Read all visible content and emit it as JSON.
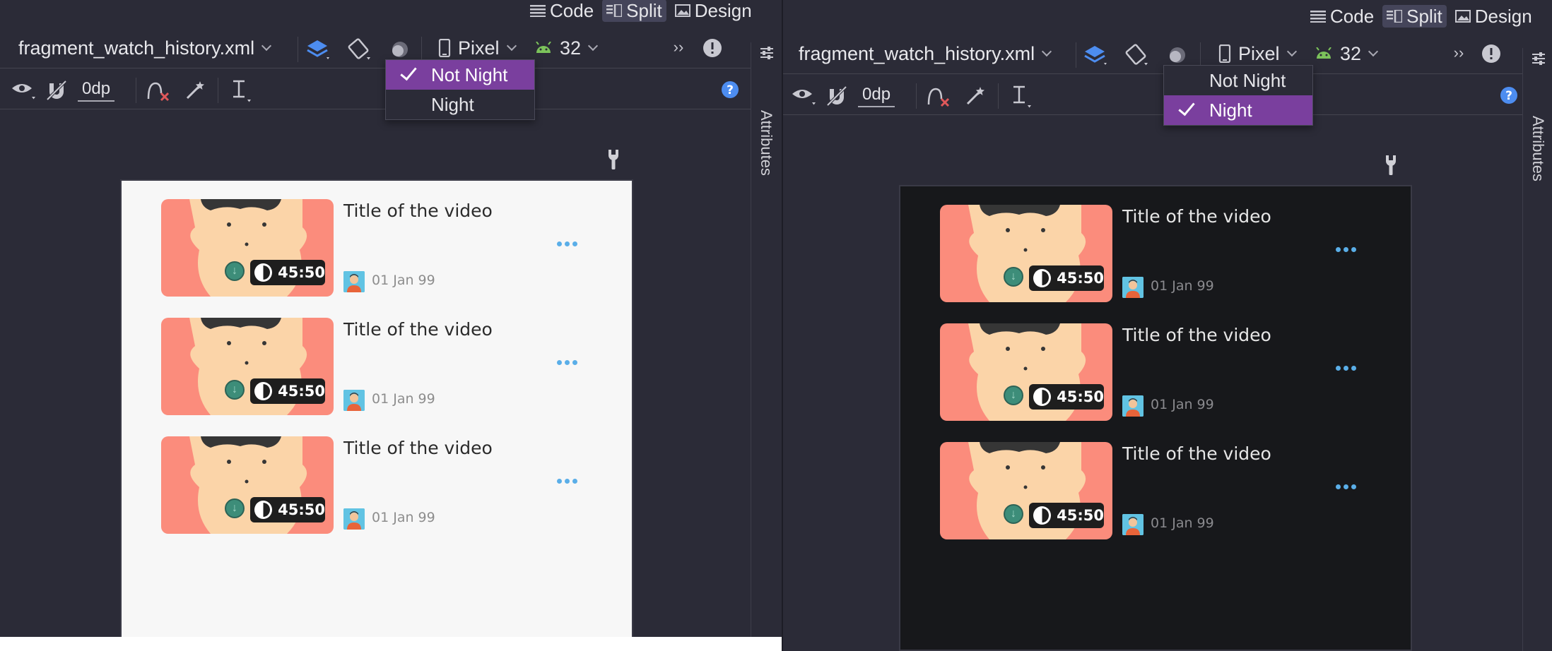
{
  "view_modes": [
    "Code",
    "Split",
    "Design"
  ],
  "active_view": "Split",
  "toolbar": {
    "filename": "fragment_watch_history.xml",
    "device": "Pixel",
    "api_level": "32",
    "margin_value": "0dp"
  },
  "side_panel": {
    "label": "Attributes"
  },
  "night_mode_menu": {
    "items": [
      "Not Night",
      "Night"
    ]
  },
  "panels": [
    {
      "id": "left",
      "theme": "light",
      "selected_mode": "Not Night"
    },
    {
      "id": "right",
      "theme": "dark",
      "selected_mode": "Night"
    }
  ],
  "video_items": [
    {
      "title": "Title of the video",
      "duration": "45:50",
      "date": "01 Jan 99"
    },
    {
      "title": "Title of the video",
      "duration": "45:50",
      "date": "01 Jan 99"
    },
    {
      "title": "Title of the video",
      "duration": "45:50",
      "date": "01 Jan 99"
    }
  ],
  "colors": {
    "accent_purple": "#7a3f9e",
    "more_dots": "#5aaee8",
    "thumbnail_bg": "#fb8c7c",
    "android_green": "#7cc35b",
    "layers_blue": "#4d8df0"
  }
}
